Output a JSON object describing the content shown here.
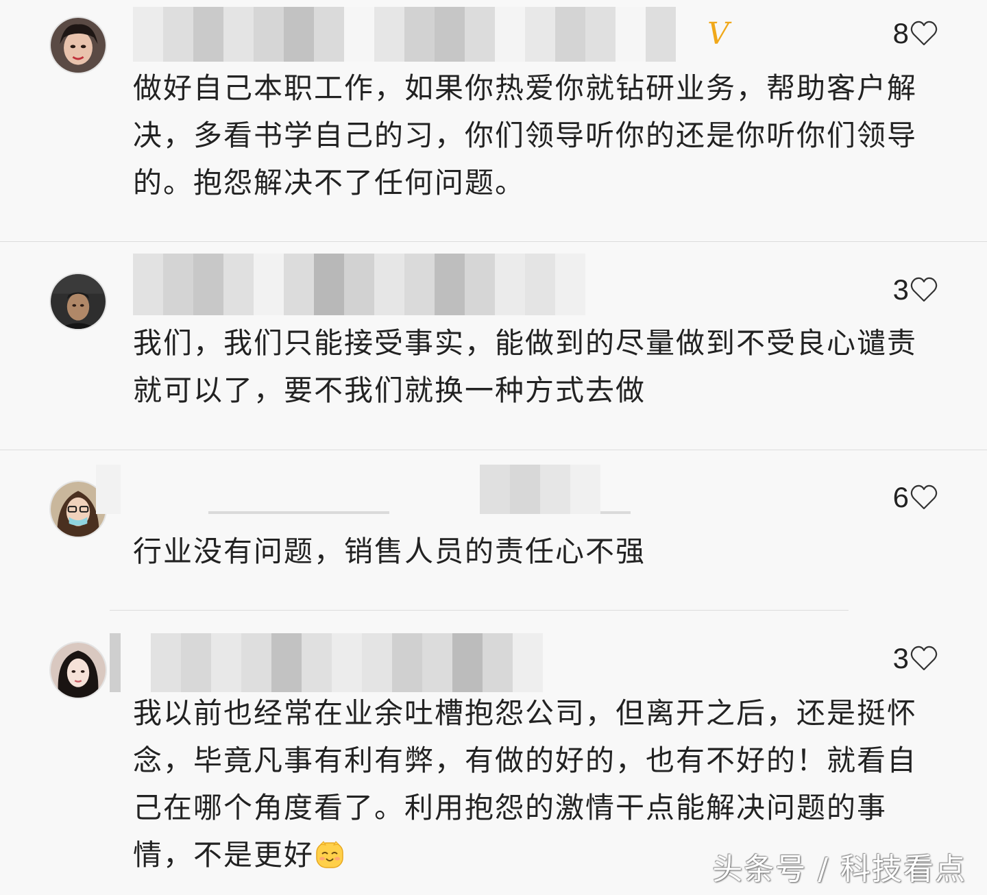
{
  "comments": [
    {
      "likes": "8",
      "text": "做好自己本职工作，如果你热爱你就钻研业务，帮助客户解决，多看书学自己的习，你们领导听你的还是你听你们领导的。抱怨解决不了任何问题。",
      "verified_badge": "V"
    },
    {
      "likes": "3",
      "text": "我们，我们只能接受事实，能做到的尽量做到不受良心谴责就可以了，要不我们就换一种方式去做"
    },
    {
      "likes": "6",
      "text": "行业没有问题，销售人员的责任心不强"
    },
    {
      "likes": "3",
      "text": "我以前也经常在业余吐槽抱怨公司，但离开之后，还是挺怀念，毕竟凡事有利有弊，有做的好的，也有不好的！就看自己在哪个角度看了。利用抱怨的激情干点能解决问题的事情，不是更好",
      "emoji": "smiling-face-emoji"
    }
  ],
  "watermark": "头条号 / 科技看点",
  "colors": {
    "background": "#f8f8f8",
    "text": "#222222",
    "divider": "#dcdcdc",
    "verified": "#f0a81a"
  }
}
